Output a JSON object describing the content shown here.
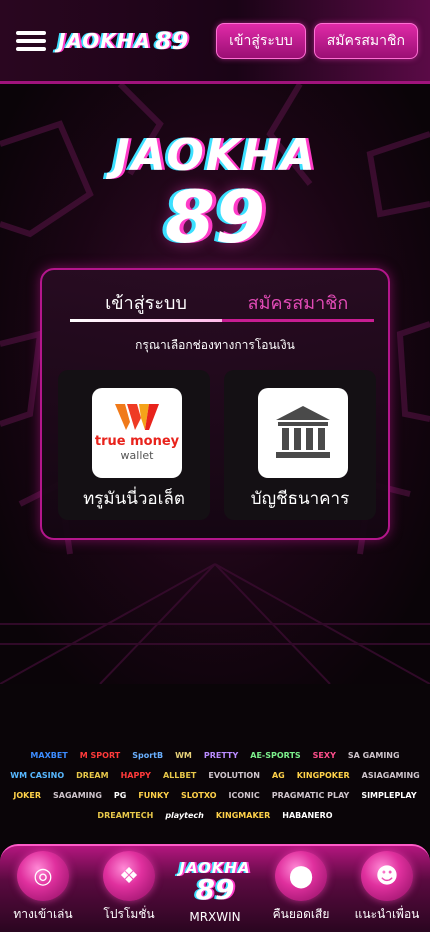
{
  "header": {
    "logo_text": "JAOKHA",
    "logo_number": "89",
    "login_label": "เข้าสู่ระบบ",
    "register_label": "สมัครสมาชิก"
  },
  "hero": {
    "logo_text": "JAOKHA",
    "logo_number": "89"
  },
  "panel": {
    "tabs": [
      {
        "label": "เข้าสู่ระบบ",
        "active": true
      },
      {
        "label": "สมัครสมาชิก",
        "active": false
      }
    ],
    "subtitle": "กรุณาเลือกช่องทางการโอนเงิน",
    "options": [
      {
        "label": "ทรูมันนี่วอเล็ต",
        "icon": "truemoney-wallet-icon",
        "brand_top": "true money",
        "brand_bottom": "wallet"
      },
      {
        "label": "บัญชีธนาคาร",
        "icon": "bank-icon"
      }
    ]
  },
  "providers": [
    "MAXBET",
    "M SPORT",
    "SportB",
    "WM",
    "PRETTY",
    "AE-SPORTS",
    "SEXY",
    "SA GAMING",
    "WM CASINO",
    "DREAM",
    "HAPPY",
    "ALLBET",
    "EVOLUTION",
    "AG",
    "KINGPOKER",
    "ASIAGAMING",
    "JOKER",
    "SAGAMING",
    "PG",
    "FUNKY",
    "SLOTXO",
    "ICONIC",
    "PRAGMATIC PLAY",
    "SIMPLEPLAY",
    "DREAMTECH",
    "playtech",
    "KINGMAKER",
    "HABANERO"
  ],
  "bottom_nav": [
    {
      "label": "ทางเข้าเล่น",
      "icon": "slot-coin-icon"
    },
    {
      "label": "โปรโมชั่น",
      "icon": "gift-icon"
    },
    {
      "label": "MRXWIN",
      "logo_text": "JAOKHA",
      "logo_number": "89"
    },
    {
      "label": "คืนยอดเสีย",
      "icon": "chips-icon"
    },
    {
      "label": "แนะนำเพื่อน",
      "icon": "friends-icon"
    }
  ],
  "colors": {
    "accent": "#e02aa8",
    "header_border": "#a0137c",
    "panel_border": "#b4168c",
    "tab_inactive": "#e24bb6"
  }
}
